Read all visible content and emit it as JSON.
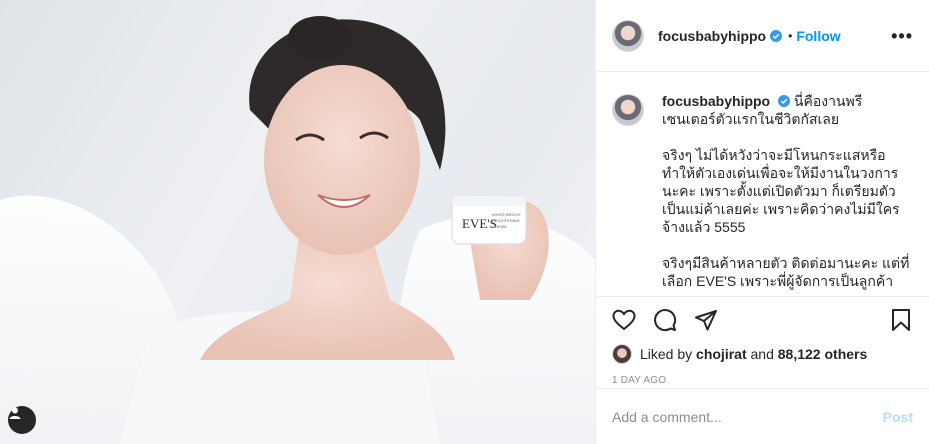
{
  "media": {
    "product_label": "EVE'S",
    "product_small_text_1": "WHITE BRIGHT",
    "product_small_text_2": "BRIGHTENING",
    "product_small_text_3": "CREAM"
  },
  "header": {
    "username": "focusbabyhippo",
    "dot": "•",
    "follow_label": "Follow",
    "more_label": "•••"
  },
  "caption": {
    "username": "focusbabyhippo",
    "first_line": "นี่คืองานพรีเซนเตอร์ตัวแรกในชีวิตกัสเลย",
    "paragraph_2": "จริงๆ ไม่ได้หวังว่าจะมีโหนกระแสหรือทำให้ตัวเองเด่นเพื่อจะให้มีงานในวงการนะคะ เพราะตั้งแต่เปิดตัวมา ก็เตรียมตัวเป็นแม่ค้าเลยค่ะ เพราะคิดว่าคงไม่มีใครจ้างแล้ว 5555",
    "paragraph_3": "จริงๆมีสินค้าหลายตัว ติดต่อมานะคะ แต่ที่เลือก EVE'S เพราะพี่ผู้จัดการเป็นลูกค้า"
  },
  "likes": {
    "prefix": "Liked by",
    "liker": "chojirat",
    "conjunction": "and",
    "count": "88,122 others"
  },
  "timestamp": "1 DAY AGO",
  "comment": {
    "placeholder": "Add a comment...",
    "post_label": "Post"
  },
  "colors": {
    "accent": "#0095f6",
    "post_disabled": "#b2dffc",
    "muted": "#8e8e8e",
    "text": "#262626"
  },
  "icons": [
    "user-tag-icon",
    "verified-badge-icon",
    "heart-icon",
    "comment-icon",
    "share-icon",
    "bookmark-icon"
  ]
}
